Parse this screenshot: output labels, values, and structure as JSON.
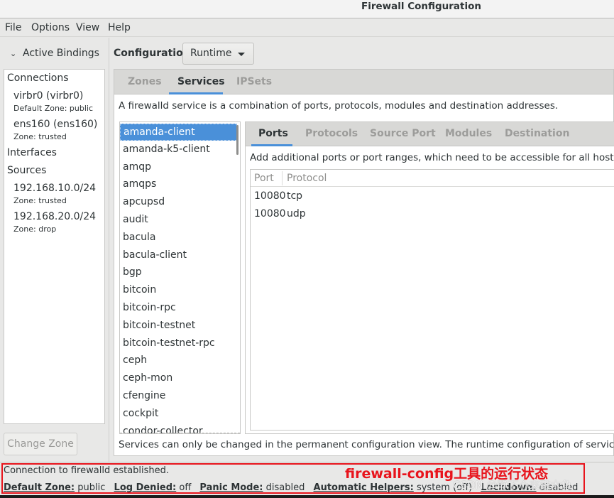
{
  "window": {
    "title": "Firewall Configuration"
  },
  "menu": [
    "File",
    "Options",
    "View",
    "Help"
  ],
  "left_panel": {
    "header": "Active Bindings",
    "connections_label": "Connections",
    "connections": [
      {
        "name": "virbr0 (virbr0)",
        "zone": "Default Zone: public"
      },
      {
        "name": "ens160 (ens160)",
        "zone": "Zone: trusted"
      }
    ],
    "interfaces_label": "Interfaces",
    "sources_label": "Sources",
    "sources": [
      {
        "name": "192.168.10.0/24",
        "zone": "Zone: trusted"
      },
      {
        "name": "192.168.20.0/24",
        "zone": "Zone: drop"
      }
    ],
    "change_zone_button": "Change Zone"
  },
  "config": {
    "label": "Configuration:",
    "value": "Runtime"
  },
  "tabs": [
    {
      "label": "Zones",
      "active": false
    },
    {
      "label": "Services",
      "active": true
    },
    {
      "label": "IPSets",
      "active": false
    }
  ],
  "services": {
    "description": "A firewalld service is a combination of ports, protocols, modules and destination addresses.",
    "selected": "amanda-client",
    "list": [
      "amanda-client",
      "amanda-k5-client",
      "amqp",
      "amqps",
      "apcupsd",
      "audit",
      "bacula",
      "bacula-client",
      "bgp",
      "bitcoin",
      "bitcoin-rpc",
      "bitcoin-testnet",
      "bitcoin-testnet-rpc",
      "ceph",
      "ceph-mon",
      "cfengine",
      "cockpit",
      "condor-collector"
    ],
    "subtabs": [
      {
        "label": "Ports",
        "active": true
      },
      {
        "label": "Protocols",
        "active": false
      },
      {
        "label": "Source Port",
        "active": false
      },
      {
        "label": "Modules",
        "active": false
      },
      {
        "label": "Destination",
        "active": false
      }
    ],
    "ports_description": "Add additional ports or port ranges, which need to be accessible for all hosts or netw",
    "ports_columns": [
      "Port",
      "Protocol"
    ],
    "ports": [
      {
        "port": "10080",
        "protocol": "tcp"
      },
      {
        "port": "10080",
        "protocol": "udp"
      }
    ],
    "footnote": "Services can only be changed in the permanent configuration view. The runtime configuration of services is fixed."
  },
  "status": {
    "message": "Connection to firewalld established.",
    "fields": [
      {
        "label": "Default Zone:",
        "value": "public"
      },
      {
        "label": "Log Denied:",
        "value": "off"
      },
      {
        "label": "Panic Mode:",
        "value": "disabled"
      },
      {
        "label": "Automatic Helpers:",
        "value": "system (off)"
      },
      {
        "label": "Lockdown:",
        "value": "disabled"
      }
    ]
  },
  "annotation": {
    "text": "firewall-config工具的运行状态",
    "color": "#e8141c"
  },
  "watermark": "CSDN @静下心来敲木鱼",
  "colors": {
    "accent": "#4a90d9",
    "selection": "#4a90d9"
  }
}
